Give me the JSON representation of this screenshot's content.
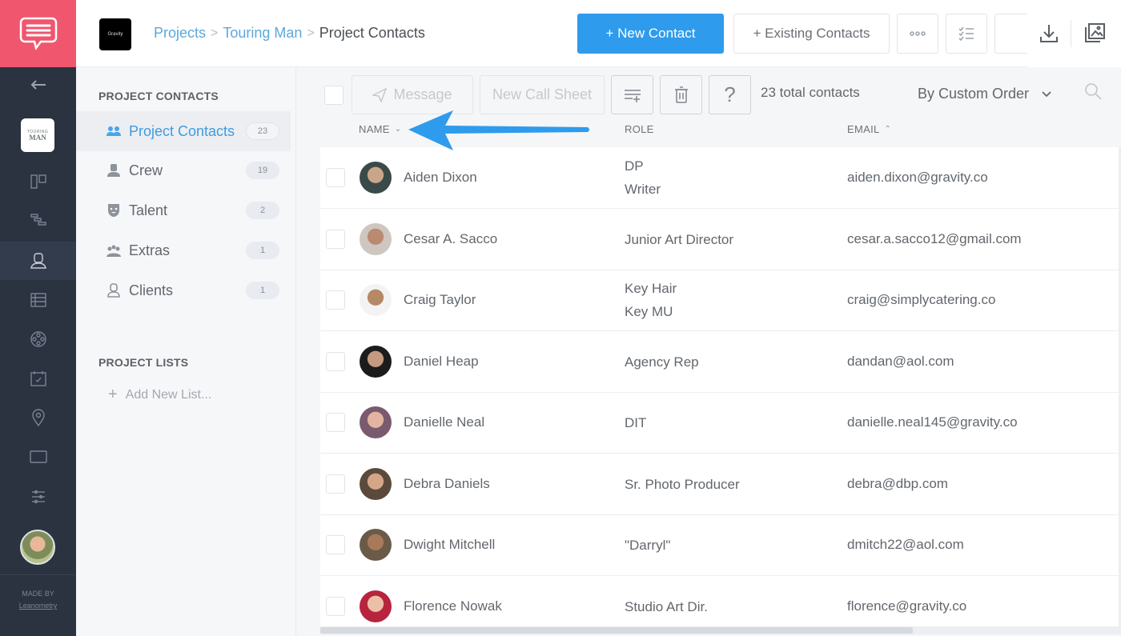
{
  "app": {
    "logo_icon": "chat-bubble-icon",
    "made_by_label": "MADE BY",
    "made_by_brand": "Leanometry"
  },
  "rail": {
    "items": [
      {
        "name": "back-arrow-icon"
      },
      {
        "name": "project-thumbnail",
        "thumb_line1": "TOURING",
        "thumb_line2": "MAN"
      },
      {
        "name": "board-icon"
      },
      {
        "name": "timeline-icon"
      },
      {
        "name": "contacts-icon",
        "active": true
      },
      {
        "name": "table-icon"
      },
      {
        "name": "film-reel-icon"
      },
      {
        "name": "calendar-check-icon"
      },
      {
        "name": "location-pin-icon"
      },
      {
        "name": "folder-icon"
      },
      {
        "name": "sliders-icon"
      }
    ]
  },
  "header": {
    "company_logo_text": "Gravity",
    "breadcrumb": [
      {
        "label": "Projects",
        "link": true
      },
      {
        "label": "Touring Man",
        "link": true
      },
      {
        "label": "Project Contacts",
        "link": false
      }
    ],
    "new_contact_label": "+ New Contact",
    "existing_contacts_label": "+ Existing Contacts",
    "more_icon": "ellipsis-icon",
    "checklist_icon": "checklist-icon",
    "download_icon": "download-icon",
    "gallery_icon": "image-gallery-icon",
    "brand_color": "#f0566e",
    "accent_color": "#2e9bed"
  },
  "panel": {
    "contacts_heading": "PROJECT CONTACTS",
    "items": [
      {
        "label": "Project Contacts",
        "count": "23",
        "icon": "group-icon",
        "active": true
      },
      {
        "label": "Crew",
        "count": "19",
        "icon": "crew-icon",
        "active": false
      },
      {
        "label": "Talent",
        "count": "2",
        "icon": "theater-mask-icon",
        "active": false
      },
      {
        "label": "Extras",
        "count": "1",
        "icon": "extras-icon",
        "active": false
      },
      {
        "label": "Clients",
        "count": "1",
        "icon": "client-icon",
        "active": false
      }
    ],
    "lists_heading": "PROJECT LISTS",
    "add_list_label": "Add New List..."
  },
  "toolbar": {
    "message_label": "Message",
    "call_sheet_label": "New Call Sheet",
    "total_label": "23 total contacts",
    "sort_label": "By Custom Order"
  },
  "table": {
    "columns": [
      {
        "label": "NAME",
        "sort": "desc"
      },
      {
        "label": "ROLE",
        "sort": ""
      },
      {
        "label": "EMAIL",
        "sort": "asc"
      }
    ],
    "rows": [
      {
        "name": "Aiden Dixon",
        "roles": [
          "DP",
          "Writer"
        ],
        "email": "aiden.dixon@gravity.co"
      },
      {
        "name": "Cesar A. Sacco",
        "roles": [
          "Junior Art Director"
        ],
        "email": "cesar.a.sacco12@gmail.com"
      },
      {
        "name": "Craig Taylor",
        "roles": [
          "Key Hair",
          "Key MU"
        ],
        "email": "craig@simplycatering.co"
      },
      {
        "name": "Daniel Heap",
        "roles": [
          "Agency Rep"
        ],
        "email": "dandan@aol.com"
      },
      {
        "name": "Danielle Neal",
        "roles": [
          "DIT"
        ],
        "email": "danielle.neal145@gravity.co"
      },
      {
        "name": "Debra Daniels",
        "roles": [
          "Sr. Photo Producer"
        ],
        "email": "debra@dbp.com"
      },
      {
        "name": "Dwight Mitchell",
        "roles": [
          "\"Darryl\""
        ],
        "email": "dmitch22@aol.com"
      },
      {
        "name": "Florence Nowak",
        "roles": [
          "Studio Art Dir."
        ],
        "email": "florence@gravity.co"
      }
    ]
  },
  "annotation": {
    "type": "arrow",
    "points_to": "NAME column sort",
    "color": "#2e9bed"
  }
}
